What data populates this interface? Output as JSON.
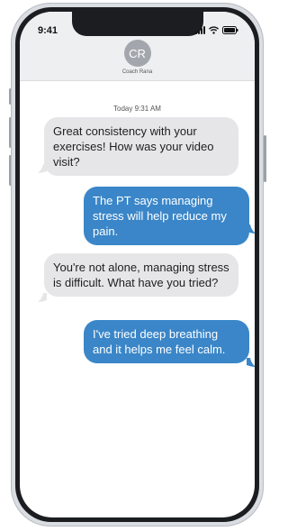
{
  "status_bar": {
    "time": "9:41"
  },
  "contact": {
    "initials": "CR",
    "name": "Coach Rana"
  },
  "conversation": {
    "timestamp": "Today 9:31 AM",
    "messages": [
      {
        "direction": "incoming",
        "text": "Great consistency with your exercises! How was your video visit?"
      },
      {
        "direction": "outgoing",
        "text": "The PT says managing stress will help reduce my pain."
      },
      {
        "direction": "incoming",
        "text": "You're not alone, managing stress is difficult. What have you tried?"
      },
      {
        "direction": "outgoing",
        "text": "I've tried deep breathing and it helps me feel calm."
      }
    ]
  },
  "colors": {
    "outgoing_bubble": "#3a86c8",
    "incoming_bubble": "#e6e6e8",
    "header_bg": "#eeeff1",
    "avatar_bg": "#a3a7ad"
  },
  "icons": [
    "signal-icon",
    "wifi-icon",
    "battery-icon"
  ]
}
